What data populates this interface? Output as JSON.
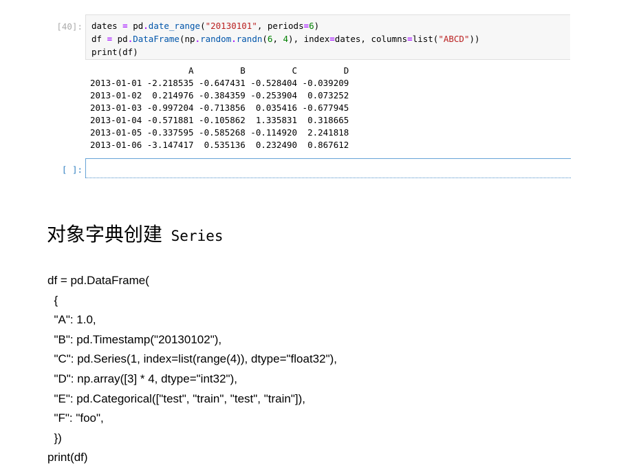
{
  "notebook": {
    "input_cell": {
      "prompt": "[40]:",
      "code_lines": [
        [
          {
            "t": "dates ",
            "c": ""
          },
          {
            "t": "=",
            "c": "op"
          },
          {
            "t": " pd",
            "c": ""
          },
          {
            "t": ".",
            "c": "op"
          },
          {
            "t": "date_range",
            "c": "attr"
          },
          {
            "t": "(",
            "c": ""
          },
          {
            "t": "\"20130101\"",
            "c": "str"
          },
          {
            "t": ", periods",
            "c": ""
          },
          {
            "t": "=",
            "c": "op"
          },
          {
            "t": "6",
            "c": "num"
          },
          {
            "t": ")",
            "c": ""
          }
        ],
        [
          {
            "t": "df ",
            "c": ""
          },
          {
            "t": "=",
            "c": "op"
          },
          {
            "t": " pd",
            "c": ""
          },
          {
            "t": ".",
            "c": "op"
          },
          {
            "t": "DataFrame",
            "c": "attr"
          },
          {
            "t": "(np",
            "c": ""
          },
          {
            "t": ".",
            "c": "op"
          },
          {
            "t": "random",
            "c": "attr"
          },
          {
            "t": ".",
            "c": "op"
          },
          {
            "t": "randn",
            "c": "attr"
          },
          {
            "t": "(",
            "c": ""
          },
          {
            "t": "6",
            "c": "num"
          },
          {
            "t": ", ",
            "c": ""
          },
          {
            "t": "4",
            "c": "num"
          },
          {
            "t": "), index",
            "c": ""
          },
          {
            "t": "=",
            "c": "op"
          },
          {
            "t": "dates, columns",
            "c": ""
          },
          {
            "t": "=",
            "c": "op"
          },
          {
            "t": "list(",
            "c": ""
          },
          {
            "t": "\"ABCD\"",
            "c": "str"
          },
          {
            "t": "))",
            "c": ""
          }
        ],
        [
          {
            "t": "print(df)",
            "c": ""
          }
        ]
      ]
    },
    "output_lines": [
      "                   A         B         C         D",
      "2013-01-01 -2.218535 -0.647431 -0.528404 -0.039209",
      "2013-01-02  0.214976 -0.384359 -0.253904  0.073252",
      "2013-01-03 -0.997204 -0.713856  0.035416 -0.677945",
      "2013-01-04 -0.571881 -0.105862  1.335831  0.318665",
      "2013-01-05 -0.337595 -0.585268 -0.114920  2.241818",
      "2013-01-06 -3.147417  0.535136  0.232490  0.867612"
    ],
    "empty_cell": {
      "prompt": "[ ]:",
      "value": ""
    }
  },
  "section": {
    "heading_cn": "对象字典创建",
    "heading_en": " Series",
    "code_lines": [
      "df = pd.DataFrame(",
      "  {",
      "  \"A\": 1.0,",
      "  \"B\": pd.Timestamp(\"20130102\"),",
      "  \"C\": pd.Series(1, index=list(range(4)), dtype=\"float32\"),",
      "  \"D\": np.array([3] * 4, dtype=\"int32\"),",
      "  \"E\": pd.Categorical([\"test\", \"train\", \"test\", \"train\"]),",
      "  \"F\": \"foo\",",
      "  })",
      "print(df)"
    ]
  },
  "colors": {
    "code_bg": "#f7f7f7",
    "keyword_operator": "#aa22ff",
    "attribute": "#0055aa",
    "string": "#ba2121",
    "number": "#008000",
    "prompt_in": "#aaaaaa",
    "prompt_active": "#307fc1",
    "active_border": "#66a3d6"
  }
}
